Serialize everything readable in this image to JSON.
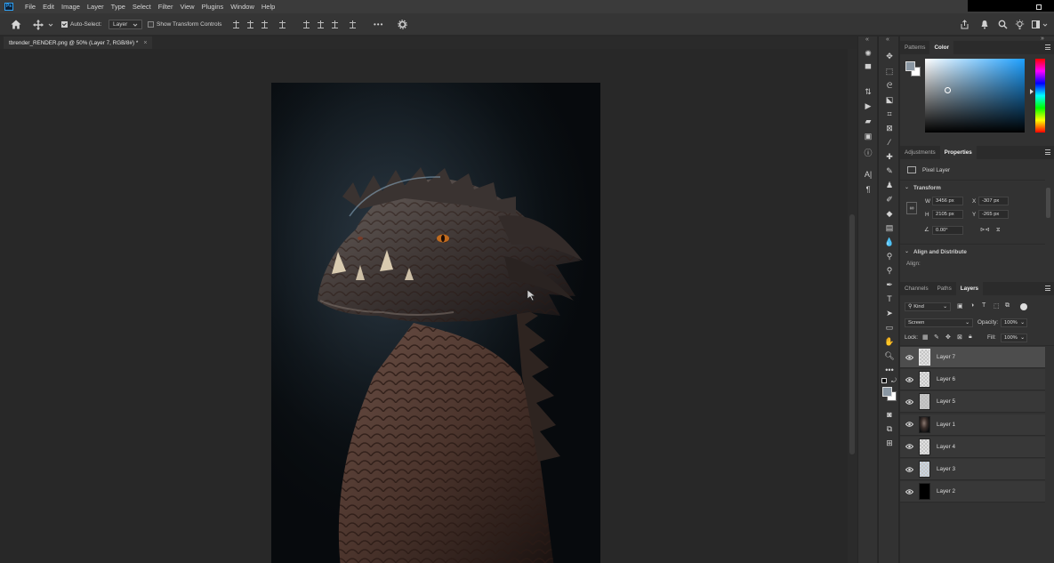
{
  "menubar": {
    "logo": "Ps",
    "items": [
      "File",
      "Edit",
      "Image",
      "Layer",
      "Type",
      "Select",
      "Filter",
      "View",
      "Plugins",
      "Window",
      "Help"
    ]
  },
  "options": {
    "auto_select_label": "Auto-Select:",
    "auto_select_checked": true,
    "auto_select_target": "Layer",
    "show_transform_label": "Show Transform Controls",
    "show_transform_checked": false,
    "more_label": "•••"
  },
  "document": {
    "tab_title": "tbrender_RENDER.png @ 50% (Layer 7, RGB/8#) *",
    "close": "×"
  },
  "panels": {
    "top_tabs": [
      "Patterns",
      "Color"
    ],
    "top_active": "Color",
    "color": {
      "foreground": "#8a97a3",
      "background": "#ffffff",
      "hue_color": "#1ea0ff"
    },
    "props_tabs": [
      "Adjustments",
      "Properties"
    ],
    "props_active": "Properties",
    "pixel_layer_label": "Pixel Layer",
    "transform_title": "Transform",
    "w_label": "W",
    "w_value": "3456 px",
    "h_label": "H",
    "h_value": "2105 px",
    "x_label": "X",
    "x_value": "-307 px",
    "y_label": "Y",
    "y_value": "-265 px",
    "angle_value": "0.00°",
    "align_title": "Align and Distribute",
    "align_label": "Align:",
    "layers_tabs": [
      "Channels",
      "Paths",
      "Layers"
    ],
    "layers_active": "Layers",
    "kind_label": "Kind",
    "blend_mode": "Screen",
    "opacity_label": "Opacity:",
    "opacity_value": "100%",
    "lock_label": "Lock:",
    "fill_label": "Fill:",
    "fill_value": "100%",
    "layers": [
      {
        "name": "Layer 7",
        "selected": true,
        "thumb": "checker"
      },
      {
        "name": "Layer 6",
        "selected": false,
        "thumb": "checker"
      },
      {
        "name": "Layer 5",
        "selected": false,
        "thumb": "checker-dark"
      },
      {
        "name": "Layer 1",
        "selected": false,
        "thumb": "image"
      },
      {
        "name": "Layer 4",
        "selected": false,
        "thumb": "checker"
      },
      {
        "name": "Layer 3",
        "selected": false,
        "thumb": "checker-blue"
      },
      {
        "name": "Layer 2",
        "selected": false,
        "thumb": "black"
      }
    ]
  },
  "toolbar": {
    "tools": [
      "move-tool",
      "artboard-tool",
      "marquee-tool",
      "lasso-tool",
      "object-select-tool",
      "crop-tool",
      "frame-tool",
      "eyedropper-tool",
      "healing-tool",
      "brush-tool",
      "clone-stamp-tool",
      "history-brush-tool",
      "eraser-tool",
      "gradient-tool",
      "blur-tool",
      "dodge-tool",
      "pen-tool",
      "type-tool",
      "path-select-tool",
      "rectangle-tool",
      "hand-tool",
      "zoom-tool",
      "edit-toolbar-tool"
    ]
  }
}
